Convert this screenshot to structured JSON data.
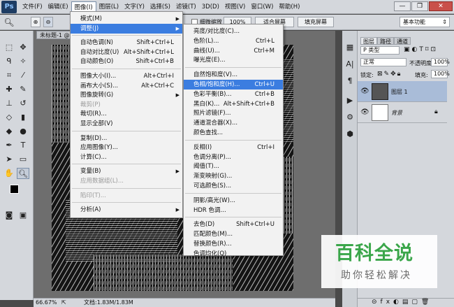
{
  "app": {
    "logo": "Ps"
  },
  "menubar": {
    "items": [
      "文件(F)",
      "编辑(E)",
      "图像(I)",
      "图层(L)",
      "文字(Y)",
      "选择(S)",
      "滤镜(T)",
      "3D(D)",
      "视图(V)",
      "窗口(W)",
      "帮助(H)"
    ],
    "active_index": 2
  },
  "window_buttons": {
    "minimize": "—",
    "restore": "❐",
    "close": "✕"
  },
  "options_bar": {
    "fine_zoom_label": "细微缩放",
    "zoom_value": "100%",
    "fit_screen": "适合屏幕",
    "fill_screen": "填充屏幕",
    "workspace": "基本功能"
  },
  "document": {
    "tab_title": "未标题-1 @",
    "status_zoom": "66.67%",
    "status_doc": "文档:1.83M/1.83M"
  },
  "image_menu": {
    "items": [
      {
        "label": "模式(M)",
        "shortcut": "",
        "submenu": true,
        "disabled": false
      },
      {
        "label": "调整(J)",
        "shortcut": "",
        "submenu": true,
        "disabled": false,
        "highlight": true
      },
      {
        "label": "自动色调(N)",
        "shortcut": "Shift+Ctrl+L",
        "disabled": false
      },
      {
        "label": "自动对比度(U)",
        "shortcut": "Alt+Shift+Ctrl+L",
        "disabled": false
      },
      {
        "label": "自动颜色(O)",
        "shortcut": "Shift+Ctrl+B",
        "disabled": false
      },
      {
        "label": "图像大小(I)...",
        "shortcut": "Alt+Ctrl+I",
        "disabled": false
      },
      {
        "label": "画布大小(S)...",
        "shortcut": "Alt+Ctrl+C",
        "disabled": false
      },
      {
        "label": "图像旋转(G)",
        "shortcut": "",
        "submenu": true,
        "disabled": false
      },
      {
        "label": "裁剪(P)",
        "shortcut": "",
        "disabled": true
      },
      {
        "label": "裁切(R)...",
        "shortcut": "",
        "disabled": false
      },
      {
        "label": "显示全部(V)",
        "shortcut": "",
        "disabled": false
      },
      {
        "label": "复制(D)...",
        "shortcut": "",
        "disabled": false
      },
      {
        "label": "应用图像(Y)...",
        "shortcut": "",
        "disabled": false
      },
      {
        "label": "计算(C)...",
        "shortcut": "",
        "disabled": false
      },
      {
        "label": "变量(B)",
        "shortcut": "",
        "submenu": true,
        "disabled": false
      },
      {
        "label": "应用数据组(L)...",
        "shortcut": "",
        "disabled": true
      },
      {
        "label": "陷印(T)...",
        "shortcut": "",
        "disabled": true
      },
      {
        "label": "分析(A)",
        "shortcut": "",
        "submenu": true,
        "disabled": false
      }
    ]
  },
  "adjust_menu": {
    "items": [
      {
        "label": "亮度/对比度(C)...",
        "shortcut": ""
      },
      {
        "label": "色阶(L)...",
        "shortcut": "Ctrl+L"
      },
      {
        "label": "曲线(U)...",
        "shortcut": "Ctrl+M"
      },
      {
        "label": "曝光度(E)...",
        "shortcut": ""
      },
      {
        "label": "自然饱和度(V)...",
        "shortcut": ""
      },
      {
        "label": "色相/饱和度(H)...",
        "shortcut": "Ctrl+U",
        "highlight": true
      },
      {
        "label": "色彩平衡(B)...",
        "shortcut": "Ctrl+B"
      },
      {
        "label": "黑白(K)...",
        "shortcut": "Alt+Shift+Ctrl+B"
      },
      {
        "label": "照片滤镜(F)...",
        "shortcut": ""
      },
      {
        "label": "通道混合器(X)...",
        "shortcut": ""
      },
      {
        "label": "颜色查找...",
        "shortcut": ""
      },
      {
        "label": "反相(I)",
        "shortcut": "Ctrl+I"
      },
      {
        "label": "色调分离(P)...",
        "shortcut": ""
      },
      {
        "label": "阈值(T)...",
        "shortcut": ""
      },
      {
        "label": "渐变映射(G)...",
        "shortcut": ""
      },
      {
        "label": "可选颜色(S)...",
        "shortcut": ""
      },
      {
        "label": "阴影/高光(W)...",
        "shortcut": ""
      },
      {
        "label": "HDR 色调...",
        "shortcut": ""
      },
      {
        "label": "去色(D)",
        "shortcut": "Shift+Ctrl+U"
      },
      {
        "label": "匹配颜色(M)...",
        "shortcut": ""
      },
      {
        "label": "替换颜色(R)...",
        "shortcut": ""
      },
      {
        "label": "色调均化(Q)",
        "shortcut": ""
      }
    ]
  },
  "layers_panel": {
    "tabs": [
      "图层",
      "路径",
      "通道"
    ],
    "filter_kind": "P 类型",
    "blend_mode": "正常",
    "opacity_label": "不透明度:",
    "opacity_value": "100%",
    "lock_label": "锁定:",
    "fill_label": "填充:",
    "fill_value": "100%",
    "layers": [
      {
        "name": "图层 1",
        "selected": true
      },
      {
        "name": "背景",
        "selected": false,
        "locked": true
      }
    ]
  },
  "watermark": {
    "title": "百科全说",
    "subtitle": "助你轻松解决"
  },
  "colors": {
    "highlight": "#3b7de0",
    "selected_layer": "#a9bcd8",
    "watermark_green": "#3aa64a"
  }
}
